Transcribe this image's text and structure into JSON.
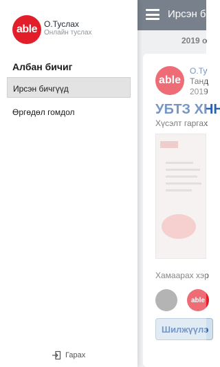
{
  "drawer": {
    "logo_text": "able",
    "app_name": "О.Туслах",
    "app_subtitle": "Онлайн туслах",
    "section_title": "Албан бичиг",
    "items": [
      {
        "label": "Ирсэн бичгүүд",
        "active": true
      },
      {
        "label": "Өргөдөл гомдол",
        "active": false
      }
    ],
    "logout_label": "Гарах"
  },
  "background": {
    "topbar_title": "Ирсэн б",
    "date_header": "2019 о",
    "card": {
      "logo_text": "able",
      "name": "О.Ту",
      "subtitle": "Танд",
      "date": "2019",
      "heading": "УБТЗ ХНН",
      "request_text": "Хүсэлт гаргах",
      "related_label": "Хамаарах хэр",
      "thumb_logo_text": "able",
      "button_label": "Шилжүүлэ"
    }
  },
  "colors": {
    "brand_red": "#e31e2b",
    "topbar": "#2f3c4d",
    "link_blue": "#2b5fa8"
  }
}
